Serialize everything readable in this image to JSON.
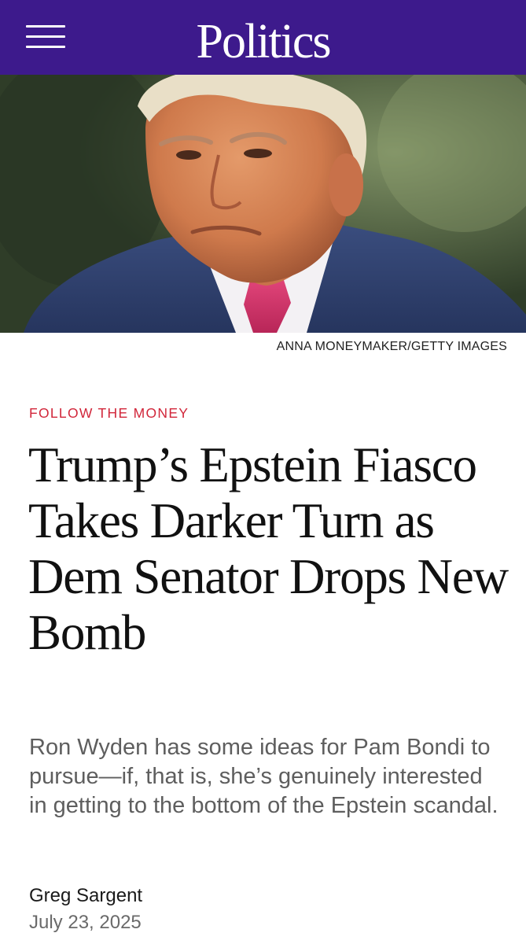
{
  "header": {
    "menu_icon": "hamburger-menu-icon",
    "section_title": "Politics",
    "background_color": "#3d1a8c"
  },
  "hero": {
    "photo_credit": "ANNA MONEYMAKER/GETTY IMAGES"
  },
  "article": {
    "kicker": "FOLLOW THE MONEY",
    "kicker_color": "#d1263a",
    "headline": "Trump’s Epstein Fiasco Takes Darker Turn as Dem Senator Drops New Bomb",
    "dek": "Ron Wyden has some ideas for Pam Bondi to pursue—if, that is, she’s genuinely interested in getting to the bottom of the Epstein scandal.",
    "author": "Greg Sargent",
    "date": "July 23, 2025"
  }
}
